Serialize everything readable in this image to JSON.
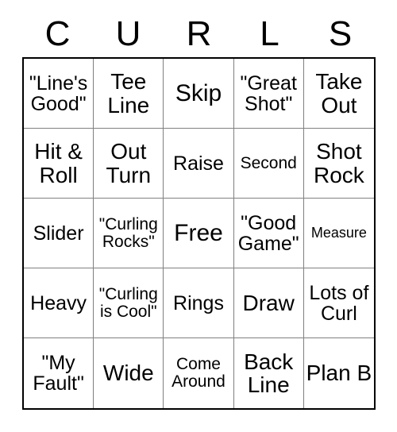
{
  "card": {
    "title_letters": [
      "C",
      "U",
      "R",
      "L",
      "S"
    ],
    "theme": "curling",
    "colors": {
      "background": "#ffffff",
      "text": "#000000",
      "grid_line": "#808080",
      "outer_border": "#000000"
    },
    "grid": {
      "rows": 5,
      "columns": 5,
      "cells": [
        {
          "text": "\"Line's Good\"",
          "size": "md"
        },
        {
          "text": "Tee Line",
          "size": "lg"
        },
        {
          "text": "Skip",
          "size": "xl"
        },
        {
          "text": "\"Great Shot\"",
          "size": "md"
        },
        {
          "text": "Take Out",
          "size": "lg"
        },
        {
          "text": "Hit & Roll",
          "size": "lg"
        },
        {
          "text": "Out Turn",
          "size": "lg"
        },
        {
          "text": "Raise",
          "size": "md"
        },
        {
          "text": "Second",
          "size": "sm"
        },
        {
          "text": "Shot Rock",
          "size": "lg"
        },
        {
          "text": "Slider",
          "size": "md"
        },
        {
          "text": "\"Curling Rocks\"",
          "size": "sm"
        },
        {
          "text": "Free",
          "size": "xl"
        },
        {
          "text": "\"Good Game\"",
          "size": "md"
        },
        {
          "text": "Measure",
          "size": "xs"
        },
        {
          "text": "Heavy",
          "size": "md"
        },
        {
          "text": "\"Curling is Cool\"",
          "size": "sm"
        },
        {
          "text": "Rings",
          "size": "md"
        },
        {
          "text": "Draw",
          "size": "lg"
        },
        {
          "text": "Lots of Curl",
          "size": "md"
        },
        {
          "text": "\"My Fault\"",
          "size": "md"
        },
        {
          "text": "Wide",
          "size": "lg"
        },
        {
          "text": "Come Around",
          "size": "sm"
        },
        {
          "text": "Back Line",
          "size": "lg"
        },
        {
          "text": "Plan B",
          "size": "lg"
        }
      ]
    }
  }
}
